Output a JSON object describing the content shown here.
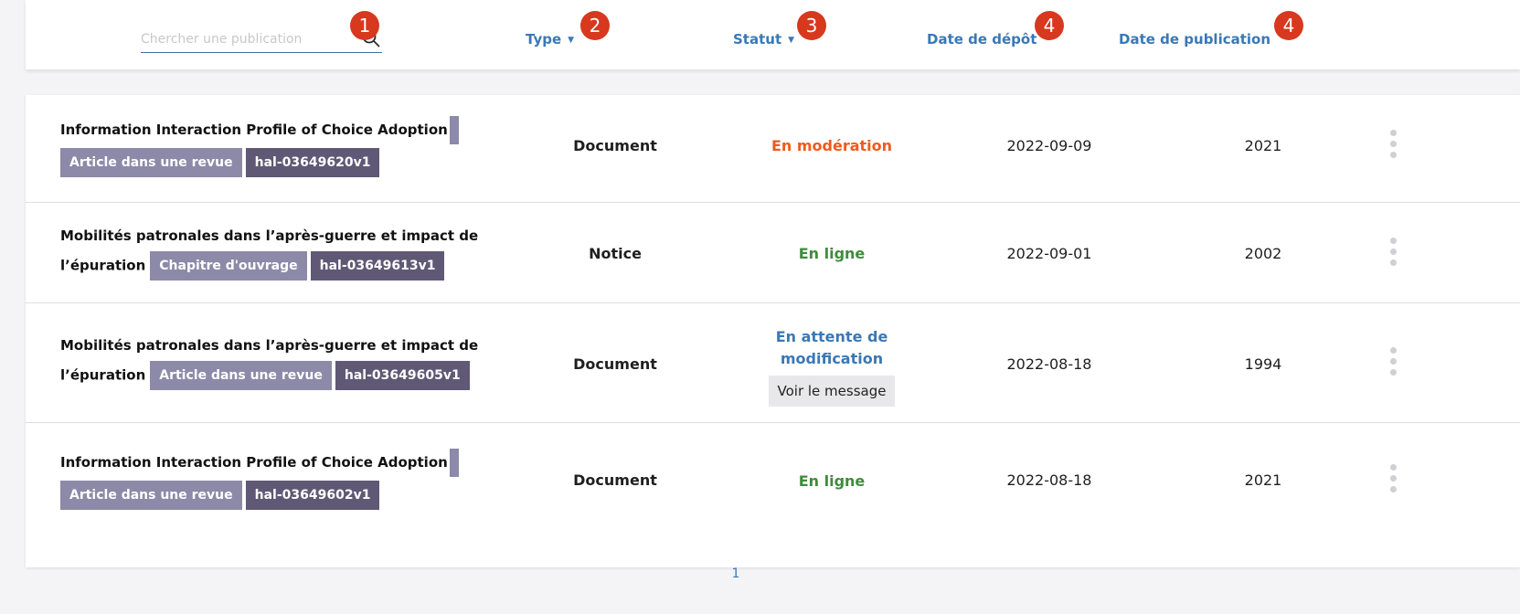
{
  "search": {
    "placeholder": "Chercher une publication",
    "value": ""
  },
  "columns": {
    "type": "Type",
    "status": "Statut",
    "deposit_date": "Date de dépôt",
    "publication_date": "Date de publication"
  },
  "badges": [
    "1",
    "2",
    "3",
    "4",
    "4"
  ],
  "rows": [
    {
      "title": "Information Interaction Profile of Choice Adoption",
      "doc_type": "Article dans une revue",
      "hal_id": "hal-03649620v1",
      "type": "Document",
      "status": "En modération",
      "status_color": "#ef5a1e",
      "deposit_date": "2022-09-09",
      "pub_year": "2021"
    },
    {
      "title_line1": "Mobilités patronales dans l’après-guerre et impact de",
      "title_line2": "l’épuration",
      "doc_type": "Chapitre d'ouvrage",
      "hal_id": "hal-03649613v1",
      "type": "Notice",
      "status": "En ligne",
      "status_color": "#3f8c3b",
      "deposit_date": "2022-09-01",
      "pub_year": "2002"
    },
    {
      "title_line1": "Mobilités patronales dans l’après-guerre et impact de",
      "title_line2": "l’épuration",
      "doc_type": "Article dans une revue",
      "hal_id": "hal-03649605v1",
      "type": "Document",
      "status_line1": "En attente de",
      "status_line2": "modification",
      "status_color": "#3a78b5",
      "message_button": "Voir le message",
      "deposit_date": "2022-08-18",
      "pub_year": "1994"
    },
    {
      "title": "Information Interaction Profile of Choice Adoption",
      "doc_type": "Article dans une revue",
      "hal_id": "hal-03649602v1",
      "type": "Document",
      "status": "En ligne",
      "status_color": "#3f8c3b",
      "deposit_date": "2022-08-18",
      "pub_year": "2021"
    }
  ],
  "pagination": {
    "current_page": "1"
  },
  "colors": {
    "accent": "#3a78b5",
    "badge": "#d7381e",
    "tag_doc_type": "#8d89a8",
    "tag_hal_id": "#5f5975"
  }
}
